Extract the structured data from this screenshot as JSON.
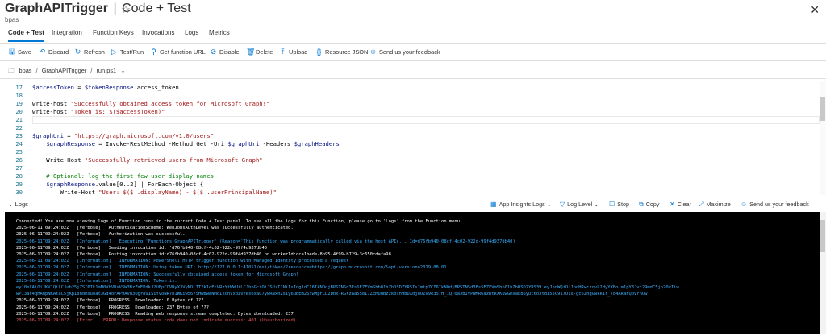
{
  "header": {
    "app_name": "GraphAPITrigger",
    "separator": "|",
    "page_name": "Code + Test",
    "extra": "☆ ···",
    "subtitle": "bpas",
    "close": "✕"
  },
  "tabs": [
    {
      "label": "Code + Test",
      "active": true
    },
    {
      "label": "Integration"
    },
    {
      "label": "Function Keys"
    },
    {
      "label": "Invocations"
    },
    {
      "label": "Logs"
    },
    {
      "label": "Metrics"
    }
  ],
  "toolbar": [
    {
      "label": "Save",
      "icon": "save-icon",
      "glyph": "🖫"
    },
    {
      "label": "Discard",
      "icon": "discard-icon",
      "glyph": "↶"
    },
    {
      "label": "Refresh",
      "icon": "refresh-icon",
      "glyph": "↻"
    },
    {
      "label": "Test/Run",
      "icon": "play-icon",
      "glyph": "▷"
    },
    {
      "label": "Get function URL",
      "icon": "link-icon",
      "glyph": "⚲"
    },
    {
      "label": "Disable",
      "icon": "disable-icon",
      "glyph": "⊘"
    },
    {
      "label": "Delete",
      "icon": "delete-icon",
      "glyph": "🗑"
    },
    {
      "label": "Upload",
      "icon": "upload-icon",
      "glyph": "⤒"
    },
    {
      "label": "Resource JSON",
      "icon": "json-icon",
      "glyph": "{}"
    },
    {
      "label": "Send us your feedback",
      "icon": "feedback-icon",
      "glyph": "☺"
    }
  ],
  "breadcrumb": {
    "icon_glyph": "🗀",
    "items": [
      "bpas",
      "GraphAPITrigger",
      "run.ps1"
    ],
    "chevron": "⌄"
  },
  "editor": {
    "lines": [
      {
        "n": "17",
        "code": "$accessToken = $tokenResponse.access_token"
      },
      {
        "n": "18",
        "code": ""
      },
      {
        "n": "19",
        "code": "write-host \"Successfully obtained access token for Microsoft Graph!\""
      },
      {
        "n": "20",
        "code": "write-host \"Token is: $($accessToken)\""
      },
      {
        "n": "21",
        "code": "",
        "current": true
      },
      {
        "n": "22",
        "code": ""
      },
      {
        "n": "23",
        "code": "$graphUri = \"https://graph.microsoft.com/v1.0/users\""
      },
      {
        "n": "24",
        "code": "    $graphResponse = Invoke-RestMethod -Method Get -Uri $graphUri -Headers $graphHeaders"
      },
      {
        "n": "25",
        "code": ""
      },
      {
        "n": "26",
        "code": "    Write-Host \"Successfully retrieved users from Microsoft Graph\""
      },
      {
        "n": "27",
        "code": ""
      },
      {
        "n": "28",
        "code": "    # Optional: log the first few user display names"
      },
      {
        "n": "29",
        "code": "    $graphResponse.value[0..2] | ForEach-Object {"
      },
      {
        "n": "30",
        "code": "        Write-Host \"User: $($_.displayName) - $($_.userPrincipalName)\""
      }
    ]
  },
  "logs_bar": {
    "title": "Logs",
    "chevron": "⌄",
    "buttons": [
      {
        "label": "App Insights Logs",
        "glyph": "▦",
        "chev": "⌄"
      },
      {
        "label": "Log Level",
        "glyph": "▽",
        "chev": "⌄"
      },
      {
        "label": "Stop",
        "glyph": "☐"
      },
      {
        "label": "Copy",
        "glyph": "⧉"
      },
      {
        "label": "Clear",
        "glyph": "✕"
      },
      {
        "label": "Maximize",
        "glyph": "⤢"
      },
      {
        "label": "Send us your feedback",
        "glyph": "☺"
      }
    ]
  },
  "console": {
    "lines": [
      {
        "text": "Connected! You are now viewing logs of Function runs in the current Code + Test panel. To see all the logs for this Function, please go to 'Logs' from the Function menu.",
        "color": "#ffffff"
      },
      {
        "text": "2025-06-11T09:24:02Z   [Verbose]   AuthenticationScheme: WebJobsAuthLevel was successfully authenticated.",
        "color": "#ffffff"
      },
      {
        "text": "2025-06-11T09:24:02Z   [Verbose]   Authorization was successful.",
        "color": "#ffffff"
      },
      {
        "text": "2025-06-11T09:24:02Z   [Information]   Executing 'Functions.GraphAPITrigger' (Reason='This function was programmatically called via the host APIs.', Id=d76fb940-08cf-4c02-922d-99f4d937db40)",
        "color": "#3ab0ff"
      },
      {
        "text": "2025-06-11T09:24:02Z   [Verbose]   Sending invocation id: 'd76fb940-08cf-4c02-922d-99f4d937db40",
        "color": "#ffffff"
      },
      {
        "text": "2025-06-11T09:24:02Z   [Verbose]   Posting invocation id:d76fb940-08cf-4c02-922d-99f4d937db40 on workerId:dca1bede-8b95-4f99-b729-3c650cdafa98",
        "color": "#ffffff"
      },
      {
        "text": "2025-06-11T09:24:02Z   [Information]   INFORMATION: PowerShell HTTP trigger function with Managed Identity processed a request",
        "color": "#3ab0ff"
      },
      {
        "text": "2025-06-11T09:24:02Z   [Information]   INFORMATION: Using token URI: http://127.0.0.1:41051/msi/token/?resource=https://graph.microsoft.com/&api-version=2019-08-01",
        "color": "#3ab0ff"
      },
      {
        "text": "2025-06-11T09:24:02Z   [Information]   INFORMATION: Successfully obtained access token for Microsoft Graph!",
        "color": "#3ab0ff"
      },
      {
        "text": "2025-06-11T09:24:02Z   [Information]   INFORMATION: Token is:",
        "color": "#3ab0ff"
      },
      {
        "text": "eyJ0eXAiOiJKV1QiLCJub25jZSI6Ik1mN0VhVUxVSW3BzZmEPdkJ2UFpCOVNyX3VyNDlIT2k1dEtVRzYtWWUiLCJhbGciOiJSUzI1NiIsIng1dCI6IkNOdjBPSTNSd3FsSEZFVmShb01hZhDSD7YRSIsImtpZCI6IkNOdjBPSTNSd3FsSEZFVmShb01hZhDSD7YRS39.eyJhdWQiOiJodHRwczovL2dyYXBoLm1pY3Jvc29mdC5jb20vIiw",
        "color": "#3ab0ff"
      },
      {
        "text": "wP13aF4qHAmpNKAtaC5jKpI8hdmxuoat3Gd4oFAP9Avd3Ogr891SiYvoNR7h1WKiw5675HwBweNMqIkchVxdzvfes6xau7ywRNxh2sIy6uBEm26YwMpFLD2Dbx-RGtzAa558I7ZEMDdBzzkblh9BDXdjdOZv9e357H_1Q-0aJBIVPWMR6azRtkXKuwGmxaE86yDt6oJtdI55C917O1s-gc6ZnqGwkk1r_7d4AkaFQ0VrnOw",
        "color": "#3ab0ff"
      },
      {
        "text": "2025-06-11T09:24:02Z   [Verbose]   PROGRESS: Downloaded: 0 Bytes of ???",
        "color": "#ffffff"
      },
      {
        "text": "2025-06-11T09:24:02Z   [Verbose]   PROGRESS: Downloaded: 237 Bytes of ???",
        "color": "#ffffff"
      },
      {
        "text": "2025-06-11T09:24:02Z   [Verbose]   PROGRESS: Reading web response stream completed. Bytes downloaded: 237",
        "color": "#ffffff"
      },
      {
        "text": "2025-06-11T09:24:02Z   [Error]   ERROR: Response status code does not indicate success: 401 (Unauthorized).",
        "color": "#f25a5a"
      }
    ]
  },
  "colors": {
    "accent": "#0078d4",
    "info": "#3ab0ff",
    "error": "#f25a5a",
    "string": "#a31515",
    "variable": "#001080",
    "comment": "#008000"
  }
}
